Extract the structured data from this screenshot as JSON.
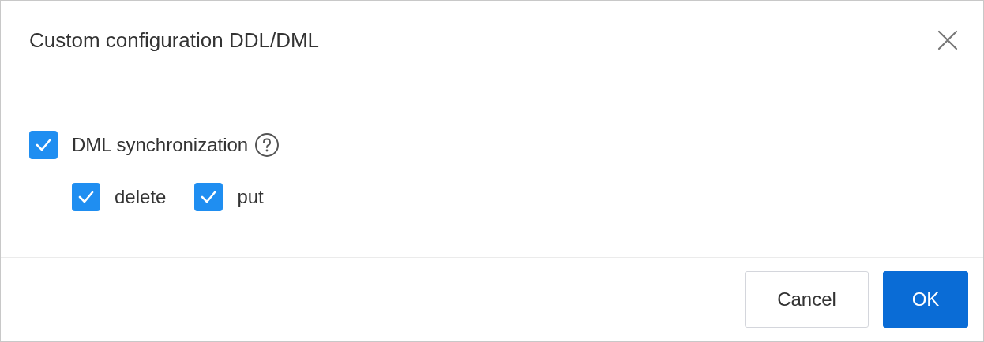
{
  "dialog": {
    "title": "Custom configuration DDL/DML"
  },
  "option": {
    "label": "DML synchronization",
    "checked": true,
    "children": [
      {
        "label": "delete",
        "checked": true
      },
      {
        "label": "put",
        "checked": true
      }
    ]
  },
  "buttons": [
    {
      "label": "Cancel",
      "kind": "secondary"
    },
    {
      "label": "OK",
      "kind": "primary"
    }
  ]
}
